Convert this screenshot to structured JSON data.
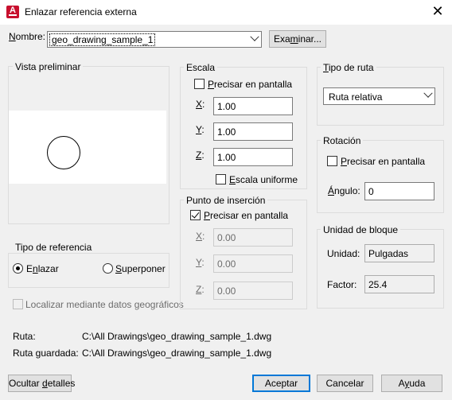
{
  "window": {
    "title": "Enlazar referencia externa",
    "close_icon": "close-icon"
  },
  "nombre": {
    "label": "Nombre:",
    "value": "geo_drawing_sample_1",
    "browse_label": "Examinar..."
  },
  "preview": {
    "title": "Vista preliminar"
  },
  "scale": {
    "title": "Escala",
    "specify_on_screen": "Precisar en pantalla",
    "x_label": "X:",
    "x_value": "1.00",
    "y_label": "Y:",
    "y_value": "1.00",
    "z_label": "Z:",
    "z_value": "1.00",
    "uniform_label": "Escala uniforme"
  },
  "insertion": {
    "title": "Punto de inserción",
    "specify_on_screen": "Precisar en pantalla",
    "x_label": "X:",
    "x_value": "0.00",
    "y_label": "Y:",
    "y_value": "0.00",
    "z_label": "Z:",
    "z_value": "0.00"
  },
  "path_type": {
    "title": "Tipo de ruta",
    "value": "Ruta relativa"
  },
  "rotation": {
    "title": "Rotación",
    "specify_on_screen": "Precisar en pantalla",
    "angle_label": "Ángulo:",
    "angle_value": "0"
  },
  "block_unit": {
    "title": "Unidad de bloque",
    "unit_label": "Unidad:",
    "unit_value": "Pulgadas",
    "factor_label": "Factor:",
    "factor_value": "25.4"
  },
  "reference_type": {
    "title": "Tipo de referencia",
    "attach_label": "Enlazar",
    "overlay_label": "Superponer"
  },
  "geo": {
    "label": "Localizar mediante datos geográficos"
  },
  "paths": {
    "ruta_label": "Ruta:",
    "ruta_value": "C:\\All Drawings\\geo_drawing_sample_1.dwg",
    "saved_label": "Ruta guardada:",
    "saved_value": "C:\\All Drawings\\geo_drawing_sample_1.dwg"
  },
  "buttons": {
    "hide_details": "Ocultar detalles",
    "ok": "Aceptar",
    "cancel": "Cancelar",
    "help": "Ayuda"
  }
}
